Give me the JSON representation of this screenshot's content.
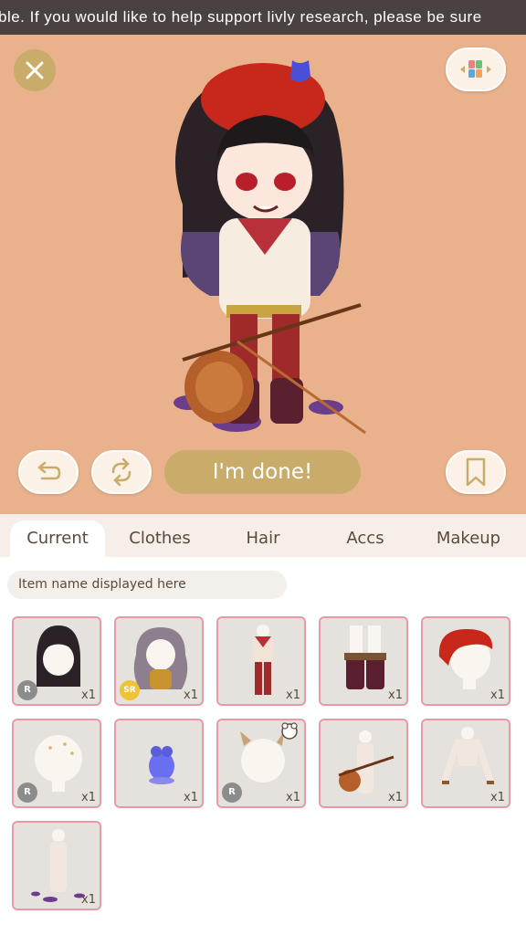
{
  "ticker": {
    "text": "ble. If you would like to help support livly research, please be sure"
  },
  "toolbar": {
    "done_label": "I'm done!"
  },
  "tabs": [
    {
      "label": "Current",
      "active": true
    },
    {
      "label": "Clothes",
      "active": false
    },
    {
      "label": "Hair",
      "active": false
    },
    {
      "label": "Accs",
      "active": false
    },
    {
      "label": "Makeup",
      "active": false
    }
  ],
  "item_name": {
    "placeholder": "Item name displayed here"
  },
  "items": [
    {
      "name": "black-hair",
      "qty": "x1",
      "rarity": "R"
    },
    {
      "name": "wavy-hair",
      "qty": "x1",
      "rarity": "SR"
    },
    {
      "name": "outfit",
      "qty": "x1",
      "rarity": ""
    },
    {
      "name": "boots",
      "qty": "x1",
      "rarity": ""
    },
    {
      "name": "red-beret",
      "qty": "x1",
      "rarity": ""
    },
    {
      "name": "sparkle-face",
      "qty": "x1",
      "rarity": "R"
    },
    {
      "name": "blue-frog",
      "qty": "x1",
      "rarity": ""
    },
    {
      "name": "horns",
      "qty": "x1",
      "rarity": "R"
    },
    {
      "name": "violin",
      "qty": "x1",
      "rarity": ""
    },
    {
      "name": "bracelets",
      "qty": "x1",
      "rarity": ""
    },
    {
      "name": "puddles",
      "qty": "x1",
      "rarity": ""
    }
  ],
  "colors": {
    "stage": "#e9b28c",
    "accent": "#c9ab6a",
    "cell_border": "#e99aa7"
  }
}
